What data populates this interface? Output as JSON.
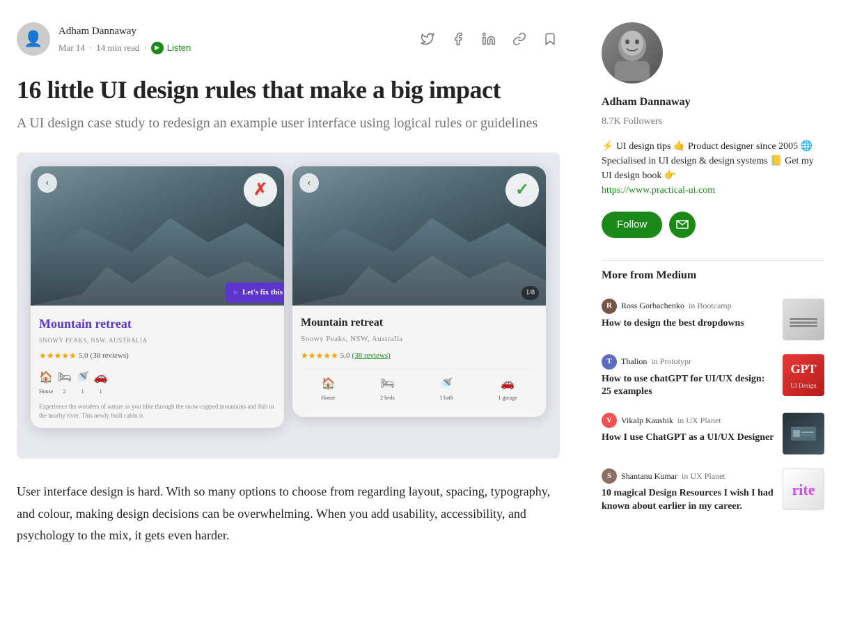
{
  "author": {
    "name": "Adham Dannaway",
    "date": "Mar 14",
    "read_time": "14 min read",
    "listen_label": "Listen",
    "followers": "8.7K Followers",
    "bio": "⚡ UI design tips 🤙 Product designer since 2005 🌐 Specialised in UI design & design systems 📒 Get my UI design book 👉",
    "website": "https://www.practical-ui.com",
    "follow_label": "Follow",
    "subscribe_icon": "✉"
  },
  "article": {
    "title": "16 little UI design rules that make a big impact",
    "subtitle": "A UI design case study to redesign an example user interface using logical rules or guidelines",
    "body_text": "User interface design is hard. With so many options to choose from regarding layout, spacing, typography, and colour, making design decisions can be overwhelming. When you add usability, accessibility, and psychology to the mix, it gets even harder.",
    "mockup": {
      "bad_title": "Mountain retreat",
      "bad_location": "SNOWY PEAKS, NSW, AUSTRALIA",
      "good_title": "Mountain retreat",
      "good_location": "Snowy Peaks, NSW, Australia",
      "rating": "5.0",
      "reviews": "(38 reviews)",
      "counter": "1/8",
      "fix_label": "Let's fix this",
      "icon_house": "🏠",
      "icon_bed": "🛏",
      "icon_bath": "🚿",
      "icon_car": "🚗",
      "label_house": "House",
      "label_beds": "2",
      "label_bath": "1",
      "label_garage": "1",
      "desc": "Experience the wonders of nature as you hike through the snow-capped mountains and fish in the nearby river. This newly built cabin is"
    }
  },
  "sidebar": {
    "more_from_medium": "More from Medium",
    "articles": [
      {
        "author_name": "Ross Gorbachenko",
        "publication": "Bootcamp",
        "title": "How to design the best dropdowns",
        "thumb_class": "thumb-1",
        "av_class": "av-ross",
        "av_initial": "R"
      },
      {
        "author_name": "Thalion",
        "publication": "Prototypr",
        "title": "How to use chatGPT for UI/UX design: 25 examples",
        "thumb_class": "thumb-2",
        "av_class": "av-thalion",
        "av_initial": "T"
      },
      {
        "author_name": "Vikalp Kaushik",
        "publication": "UX Planet",
        "title": "How I use ChatGPT as a UI/UX Designer",
        "thumb_class": "thumb-3",
        "av_class": "av-vikalp",
        "av_initial": "V"
      },
      {
        "author_name": "Shantanu Kumar",
        "publication": "UX Planet",
        "title": "10 magical Design Resources I wish I had known about earlier in my career.",
        "thumb_class": "thumb-4",
        "av_class": "av-shantanu",
        "av_initial": "S"
      }
    ]
  },
  "icons": {
    "twitter": "𝕏",
    "facebook": "f",
    "linkedin": "in",
    "link": "🔗",
    "bookmark": "🔖",
    "play": "▶"
  }
}
